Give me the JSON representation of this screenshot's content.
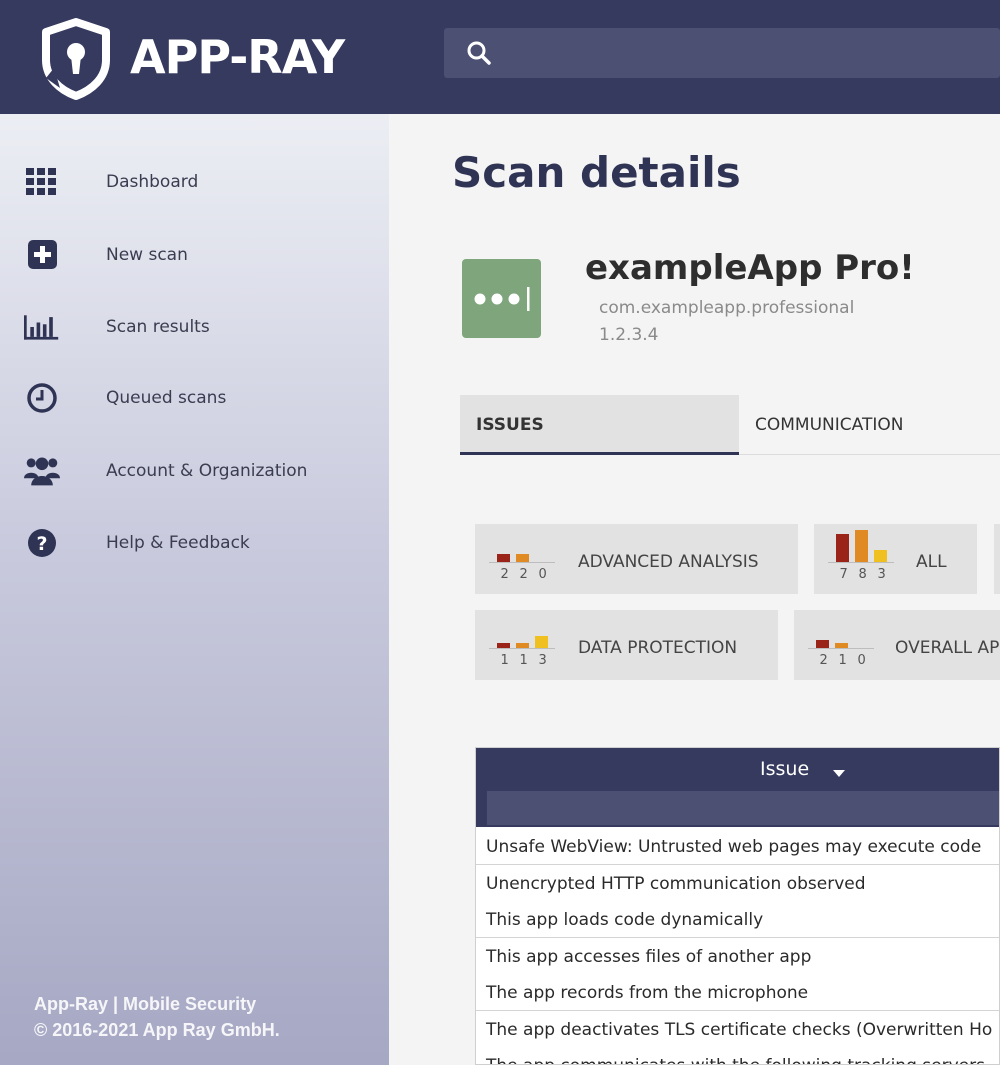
{
  "header": {
    "brand": "APP-RAY",
    "search_placeholder": ""
  },
  "sidebar": {
    "items": [
      {
        "label": "Dashboard",
        "icon": "grid-icon"
      },
      {
        "label": "New scan",
        "icon": "plus-square-icon"
      },
      {
        "label": "Scan results",
        "icon": "bar-chart-icon"
      },
      {
        "label": "Queued scans",
        "icon": "clock-icon"
      },
      {
        "label": "Account & Organization",
        "icon": "users-icon"
      },
      {
        "label": "Help & Feedback",
        "icon": "help-icon"
      }
    ],
    "footer_line1": "App-Ray | Mobile Security",
    "footer_line2": "© 2016-2021 App Ray GmbH."
  },
  "main": {
    "title": "Scan details",
    "app": {
      "name": "exampleApp Pro!",
      "package": "com.exampleapp.professional",
      "version": "1.2.3.4"
    },
    "tabs": [
      {
        "label": "ISSUES",
        "active": true
      },
      {
        "label": "COMMUNICATION",
        "active": false
      }
    ],
    "categories": [
      {
        "label": "ADVANCED ANALYSIS",
        "counts": {
          "high": 2,
          "medium": 2,
          "low": 0
        }
      },
      {
        "label": "ALL",
        "counts": {
          "high": 7,
          "medium": 8,
          "low": 3
        }
      },
      {
        "label": "DATA PROTECTION",
        "counts": {
          "high": 1,
          "medium": 1,
          "low": 3
        }
      },
      {
        "label": "OVERALL AP",
        "counts": {
          "high": 2,
          "medium": 1,
          "low": 0
        }
      }
    ],
    "severity_colors": {
      "high": "#9b2418",
      "medium": "#e08a24",
      "low": "#f0c020"
    },
    "table": {
      "column_header": "Issue",
      "rows": [
        "Unsafe WebView: Untrusted web pages may execute code",
        "Unencrypted HTTP communication observed",
        "This app loads code dynamically",
        "This app accesses files of another app",
        "The app records from the microphone",
        "The app deactivates TLS certificate checks (Overwritten Ho",
        "The app communicates with the following tracking servers"
      ]
    }
  }
}
